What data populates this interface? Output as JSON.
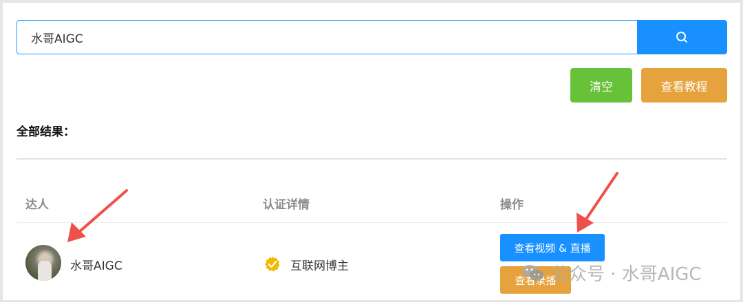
{
  "search": {
    "value": "水哥AIGC",
    "button_icon": "search-icon"
  },
  "buttons": {
    "clear": "清空",
    "tutorial": "查看教程"
  },
  "results": {
    "title": "全部结果：",
    "columns": [
      "达人",
      "认证详情",
      "操作"
    ],
    "rows": [
      {
        "name": "水哥AIGC",
        "verification": "互联网博主",
        "actions": {
          "video_live": "查看视频 & 直播",
          "replay": "查看录播"
        }
      }
    ]
  },
  "watermark": {
    "text": "公众号 · 水哥AIGC",
    "icon": "wechat-icon"
  },
  "colors": {
    "primary": "#1890ff",
    "success": "#67c23a",
    "warning": "#e6a23c",
    "annotation": "#f0504a",
    "verify_badge": "#f5b800"
  }
}
